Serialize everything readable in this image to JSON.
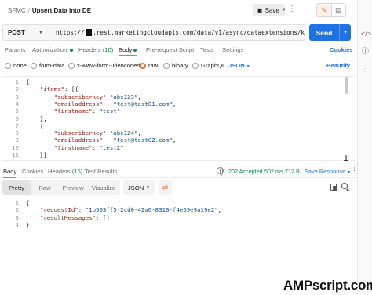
{
  "header": {
    "breadcrumb_parent": "SFMC",
    "breadcrumb_separator": "/",
    "breadcrumb_current": "Upsert Data into DE",
    "save_label": "Save",
    "more_label": "⋮"
  },
  "request": {
    "method": "POST",
    "url_prefix": "https://",
    "url_suffix": ".rest.marketingcloudapis.com/data/v1/async/dataextensions/k",
    "send_label": "Send"
  },
  "request_tabs": {
    "params": "Params",
    "authorization": "Authorization",
    "headers": "Headers",
    "headers_count": "(10)",
    "body": "Body",
    "pre_request": "Pre-request Script",
    "tests": "Tests",
    "settings": "Settings",
    "cookies": "Cookies"
  },
  "body_types": {
    "none": "none",
    "form_data": "form-data",
    "urlencoded": "x-www-form-urlencoded",
    "raw": "raw",
    "binary": "binary",
    "graphql": "GraphQL",
    "selected": "raw",
    "format": "JSON",
    "beautify": "Beautify"
  },
  "request_body": {
    "lines": [
      {
        "n": "1",
        "parts": [
          {
            "t": "{",
            "c": "p"
          }
        ]
      },
      {
        "n": "2",
        "parts": [
          {
            "t": "    ",
            "c": "p"
          },
          {
            "t": "\"items\"",
            "c": "k"
          },
          {
            "t": ": [{",
            "c": "p"
          }
        ]
      },
      {
        "n": "3",
        "parts": [
          {
            "t": "        ",
            "c": "p"
          },
          {
            "t": "\"subscriberkey\"",
            "c": "k"
          },
          {
            "t": ":",
            "c": "p"
          },
          {
            "t": "\"abc123\"",
            "c": "s"
          },
          {
            "t": ",",
            "c": "p"
          }
        ]
      },
      {
        "n": "4",
        "parts": [
          {
            "t": "        ",
            "c": "p"
          },
          {
            "t": "\"emailaddress\"",
            "c": "k"
          },
          {
            "t": " : ",
            "c": "p"
          },
          {
            "t": "\"test@test01.com\"",
            "c": "s"
          },
          {
            "t": ",",
            "c": "p"
          }
        ]
      },
      {
        "n": "5",
        "parts": [
          {
            "t": "        ",
            "c": "p"
          },
          {
            "t": "\"firstname\"",
            "c": "k"
          },
          {
            "t": ": ",
            "c": "p"
          },
          {
            "t": "\"test\"",
            "c": "s"
          }
        ]
      },
      {
        "n": "6",
        "parts": [
          {
            "t": "    },",
            "c": "p"
          }
        ]
      },
      {
        "n": "7",
        "parts": [
          {
            "t": "    {",
            "c": "p"
          }
        ]
      },
      {
        "n": "8",
        "parts": [
          {
            "t": "        ",
            "c": "p"
          },
          {
            "t": "\"subscriberkey\"",
            "c": "k"
          },
          {
            "t": ":",
            "c": "p"
          },
          {
            "t": "\"abc124\"",
            "c": "s"
          },
          {
            "t": ",",
            "c": "p"
          }
        ]
      },
      {
        "n": "9",
        "parts": [
          {
            "t": "        ",
            "c": "p"
          },
          {
            "t": "\"emailaddress\"",
            "c": "k"
          },
          {
            "t": " : ",
            "c": "p"
          },
          {
            "t": "\"test@test02.com\"",
            "c": "s"
          },
          {
            "t": ",",
            "c": "p"
          }
        ]
      },
      {
        "n": "10",
        "parts": [
          {
            "t": "        ",
            "c": "p"
          },
          {
            "t": "\"firstname\"",
            "c": "k"
          },
          {
            "t": ": ",
            "c": "p"
          },
          {
            "t": "\"test2\"",
            "c": "s"
          }
        ]
      },
      {
        "n": "11",
        "parts": [
          {
            "t": "    }]",
            "c": "p"
          }
        ]
      }
    ]
  },
  "response_tabs": {
    "body": "Body",
    "cookies": "Cookies",
    "headers": "Headers",
    "headers_count": "(15)",
    "test_results": "Test Results"
  },
  "response_status": {
    "status": "202 Accepted",
    "time": "502 ms",
    "size": "712 B",
    "save_response": "Save Response"
  },
  "response_view": {
    "pretty": "Pretty",
    "raw": "Raw",
    "preview": "Preview",
    "visualize": "Visualize",
    "format": "JSON"
  },
  "response_body": {
    "lines": [
      {
        "n": "1",
        "parts": [
          {
            "t": "{",
            "c": "p"
          }
        ]
      },
      {
        "n": "2",
        "parts": [
          {
            "t": "    ",
            "c": "p"
          },
          {
            "t": "\"requestId\"",
            "c": "k"
          },
          {
            "t": ": ",
            "c": "p"
          },
          {
            "t": "\"1b503ff5-2cd0-42a0-8310-f4e69e9a19e2\"",
            "c": "s"
          },
          {
            "t": ",",
            "c": "p"
          }
        ]
      },
      {
        "n": "3",
        "parts": [
          {
            "t": "    ",
            "c": "p"
          },
          {
            "t": "\"resultMessages\"",
            "c": "k"
          },
          {
            "t": ": []",
            "c": "p"
          }
        ]
      },
      {
        "n": "4",
        "parts": [
          {
            "t": "}",
            "c": "p"
          }
        ]
      }
    ]
  },
  "watermark": "AMPscript.com",
  "icons": {
    "save": "save-icon",
    "edit": "pencil-icon",
    "comment": "comment-icon",
    "code": "code-icon",
    "info": "info-icon",
    "lightbulb": "lightbulb-icon",
    "globe": "globe-icon",
    "copy": "copy-icon",
    "search": "search-icon",
    "wrap": "wrap-icon"
  },
  "colors": {
    "accent": "#ff6c37",
    "send_blue": "#1f72e6",
    "status_green": "#0a8f46",
    "json_key": "#a11c12",
    "json_string": "#0b52a3"
  }
}
